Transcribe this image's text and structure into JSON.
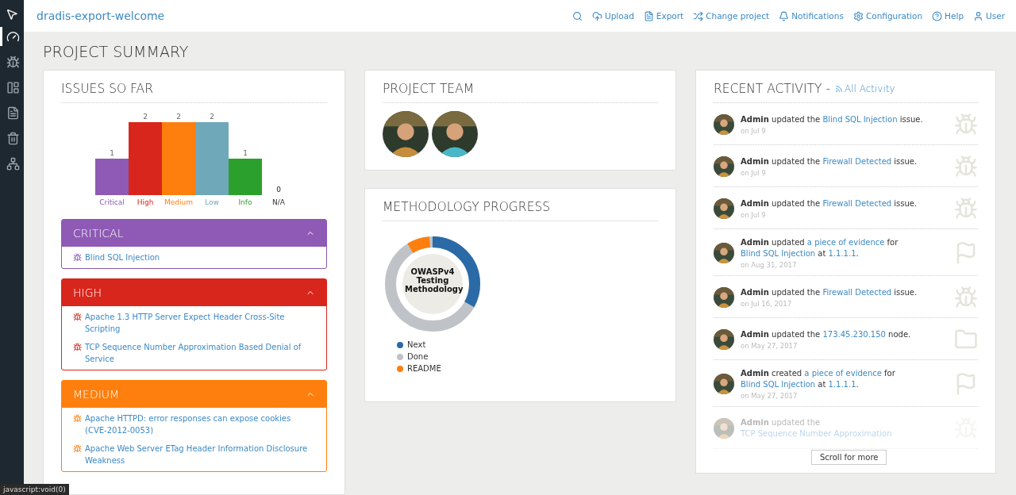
{
  "header": {
    "project": "dradis-export-welcome",
    "nav": [
      {
        "kind": "icon"
      },
      {
        "kind": "link",
        "label": "Upload"
      },
      {
        "kind": "link",
        "label": "Export"
      },
      {
        "kind": "link",
        "label": "Change project"
      },
      {
        "kind": "link",
        "label": "Notifications"
      },
      {
        "kind": "link",
        "label": "Configuration"
      },
      {
        "kind": "link",
        "label": "Help"
      },
      {
        "kind": "link",
        "label": "User"
      }
    ]
  },
  "sidebar": {
    "items": [
      {
        "selected": true
      },
      {
        "selected": false
      },
      {
        "selected": false
      },
      {
        "selected": false
      },
      {
        "selected": false
      },
      {
        "selected": false
      }
    ]
  },
  "page_title": "PROJECT SUMMARY",
  "issues": {
    "title": "ISSUES SO FAR",
    "chart_data": {
      "type": "bar",
      "categories": [
        "Critical",
        "High",
        "Medium",
        "Low",
        "Info",
        "N/A"
      ],
      "data_labels": true,
      "series": [
        {
          "color": "#8e5ab5",
          "values": [
            1,
            null,
            null,
            null,
            null,
            null
          ]
        },
        {
          "color": "#d9261c",
          "values": [
            null,
            2,
            null,
            null,
            null,
            null
          ]
        },
        {
          "color": "#ff7f0e",
          "values": [
            null,
            null,
            2,
            null,
            null,
            null
          ]
        },
        {
          "color": "#6fa8b8",
          "values": [
            null,
            null,
            null,
            2,
            null,
            null
          ]
        },
        {
          "color": "#2ca02c",
          "values": [
            null,
            null,
            null,
            null,
            1,
            null
          ]
        },
        {
          "color": "#333333",
          "values": [
            null,
            null,
            null,
            null,
            null,
            0
          ]
        }
      ]
    },
    "groups": [
      {
        "title": "CRITICAL",
        "color": "#8e5ab5",
        "expanded": true,
        "items": [
          "Blind SQL Injection"
        ]
      },
      {
        "title": "HIGH",
        "color": "#d9261c",
        "expanded": true,
        "items": [
          "Apache 1.3 HTTP Server Expect Header Cross-Site Scripting",
          "TCP Sequence Number Approximation Based Denial of Service"
        ]
      },
      {
        "title": "MEDIUM",
        "color": "#ff7f0e",
        "expanded": true,
        "items": [
          "Apache HTTPD: error responses can expose cookies (CVE-2012-0053)",
          "Apache Web Server ETag Header Information Disclosure Weakness"
        ]
      }
    ]
  },
  "team": {
    "title": "PROJECT TEAM"
  },
  "methodology": {
    "title": "METHODOLOGY PROGRESS",
    "center_label": "OWASPv4 Testing Methodology",
    "legend": [
      {
        "label": "Next",
        "color": "#2a6aa6"
      },
      {
        "label": "Done",
        "color": "#bfc3c7"
      },
      {
        "label": "README",
        "color": "#ff7f0e"
      }
    ]
  },
  "activity": {
    "title": "RECENT ACTIVITY -",
    "link": "All Activity",
    "scroll_button": "Scroll for more",
    "items": [
      {
        "kind": "bug",
        "faded": false,
        "parts": [
          {
            "kind": "actor",
            "text": "Admin"
          },
          {
            "kind": "text",
            "text": " updated the "
          },
          {
            "kind": "link",
            "text": "Blind SQL Injection"
          },
          {
            "kind": "text",
            "text": " issue."
          }
        ],
        "time": "on Jul 9"
      },
      {
        "kind": "bug",
        "faded": false,
        "parts": [
          {
            "kind": "actor",
            "text": "Admin"
          },
          {
            "kind": "text",
            "text": " updated the "
          },
          {
            "kind": "link",
            "text": "Firewall Detected"
          },
          {
            "kind": "text",
            "text": " issue."
          }
        ],
        "time": "on Jul 9"
      },
      {
        "kind": "bug",
        "faded": false,
        "parts": [
          {
            "kind": "actor",
            "text": "Admin"
          },
          {
            "kind": "text",
            "text": " updated the "
          },
          {
            "kind": "link",
            "text": "Firewall Detected"
          },
          {
            "kind": "text",
            "text": " issue."
          }
        ],
        "time": "on Jul 9"
      },
      {
        "kind": "flag",
        "faded": false,
        "parts": [
          {
            "kind": "actor",
            "text": "Admin"
          },
          {
            "kind": "text",
            "text": " updated "
          },
          {
            "kind": "link",
            "text": "a piece of evidence"
          },
          {
            "kind": "text",
            "text": " for "
          },
          {
            "kind": "link",
            "text": "Blind SQL Injection"
          },
          {
            "kind": "text",
            "text": " at "
          },
          {
            "kind": "link",
            "text": "1.1.1.1"
          },
          {
            "kind": "text",
            "text": "."
          }
        ],
        "time": "on Aug 31, 2017"
      },
      {
        "kind": "bug",
        "faded": false,
        "parts": [
          {
            "kind": "actor",
            "text": "Admin"
          },
          {
            "kind": "text",
            "text": " updated the "
          },
          {
            "kind": "link",
            "text": "Firewall Detected"
          },
          {
            "kind": "text",
            "text": " issue."
          }
        ],
        "time": "on Jul 16, 2017"
      },
      {
        "kind": "folder",
        "faded": false,
        "parts": [
          {
            "kind": "actor",
            "text": "Admin"
          },
          {
            "kind": "text",
            "text": " updated the "
          },
          {
            "kind": "link",
            "text": "173.45.230.150"
          },
          {
            "kind": "text",
            "text": " node."
          }
        ],
        "time": "on May 27, 2017"
      },
      {
        "kind": "flag",
        "faded": false,
        "parts": [
          {
            "kind": "actor",
            "text": "Admin"
          },
          {
            "kind": "text",
            "text": " created "
          },
          {
            "kind": "link",
            "text": "a piece of evidence"
          },
          {
            "kind": "text",
            "text": " for "
          },
          {
            "kind": "link",
            "text": "Blind SQL Injection"
          },
          {
            "kind": "text",
            "text": " at "
          },
          {
            "kind": "link",
            "text": "1.1.1.1"
          },
          {
            "kind": "text",
            "text": "."
          }
        ],
        "time": "on May 27, 2017"
      },
      {
        "kind": "bug",
        "faded": true,
        "parts": [
          {
            "kind": "actor",
            "text": "Admin"
          },
          {
            "kind": "text",
            "text": " updated the "
          },
          {
            "kind": "link",
            "text": "TCP Sequence Number Approximation"
          }
        ]
      }
    ]
  },
  "status_bar": "javascript:void(0)"
}
